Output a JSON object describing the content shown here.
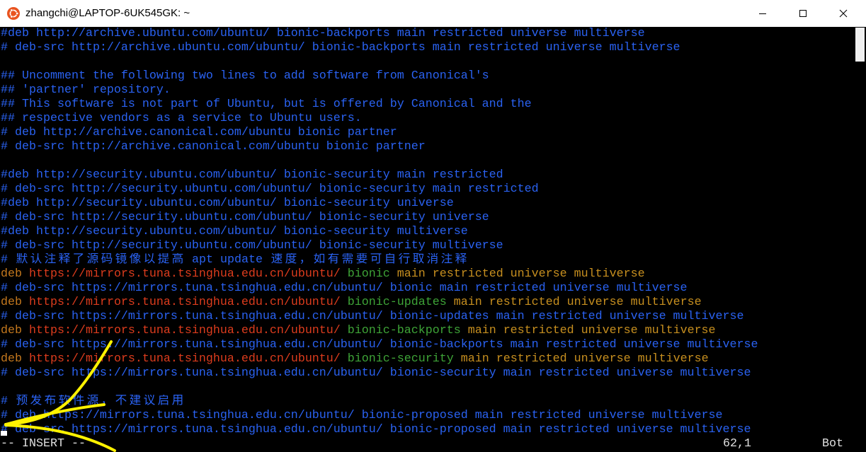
{
  "window": {
    "title": "zhangchi@LAPTOP-6UK545GK: ~",
    "icon": "ubuntu-logo-icon",
    "controls": [
      "minimize-icon",
      "maximize-icon",
      "close-icon"
    ]
  },
  "colors": {
    "comment": "#2a62f2",
    "keyword": "#c4781d",
    "url": "#dd3c1d",
    "release": "#3ea437",
    "components": "#c78f1f",
    "status_text": "#e0e0e0",
    "terminal_bg": "#000000",
    "ubuntu_orange": "#e95420",
    "annotation_arrow": "#fff200",
    "cursor": "#ffffff"
  },
  "terminal": {
    "lines": [
      {
        "segments": [
          {
            "text": "#deb http://archive.ubuntu.com/ubuntu/ bionic-backports main restricted universe multiverse",
            "style": "comment"
          }
        ]
      },
      {
        "segments": [
          {
            "text": "# deb-src http://archive.ubuntu.com/ubuntu/ bionic-backports main restricted universe multiverse",
            "style": "comment"
          }
        ]
      },
      {
        "segments": []
      },
      {
        "segments": [
          {
            "text": "## Uncomment the following two lines to add software from Canonical's",
            "style": "comment"
          }
        ]
      },
      {
        "segments": [
          {
            "text": "## 'partner' repository.",
            "style": "comment"
          }
        ]
      },
      {
        "segments": [
          {
            "text": "## This software is not part of Ubuntu, but is offered by Canonical and the",
            "style": "comment"
          }
        ]
      },
      {
        "segments": [
          {
            "text": "## respective vendors as a service to Ubuntu users.",
            "style": "comment"
          }
        ]
      },
      {
        "segments": [
          {
            "text": "# deb http://archive.canonical.com/ubuntu bionic partner",
            "style": "comment"
          }
        ]
      },
      {
        "segments": [
          {
            "text": "# deb-src http://archive.canonical.com/ubuntu bionic partner",
            "style": "comment"
          }
        ]
      },
      {
        "segments": []
      },
      {
        "segments": [
          {
            "text": "#deb http://security.ubuntu.com/ubuntu/ bionic-security main restricted",
            "style": "comment"
          }
        ]
      },
      {
        "segments": [
          {
            "text": "# deb-src http://security.ubuntu.com/ubuntu/ bionic-security main restricted",
            "style": "comment"
          }
        ]
      },
      {
        "segments": [
          {
            "text": "#deb http://security.ubuntu.com/ubuntu/ bionic-security universe",
            "style": "comment"
          }
        ]
      },
      {
        "segments": [
          {
            "text": "# deb-src http://security.ubuntu.com/ubuntu/ bionic-security universe",
            "style": "comment"
          }
        ]
      },
      {
        "segments": [
          {
            "text": "#deb http://security.ubuntu.com/ubuntu/ bionic-security multiverse",
            "style": "comment"
          }
        ]
      },
      {
        "segments": [
          {
            "text": "# deb-src http://security.ubuntu.com/ubuntu/ bionic-security multiverse",
            "style": "comment"
          }
        ]
      },
      {
        "segments": [
          {
            "text": "# 默认注释了源码镜像以提高 apt update 速度，如有需要可自行取消注释",
            "style": "comment"
          }
        ]
      },
      {
        "segments": [
          {
            "text": "deb",
            "style": "keyword"
          },
          {
            "text": " https://mirrors.tuna.tsinghua.edu.cn/ubuntu/",
            "style": "url"
          },
          {
            "text": " bionic",
            "style": "release"
          },
          {
            "text": " main restricted universe multiverse",
            "style": "components"
          }
        ]
      },
      {
        "segments": [
          {
            "text": "# deb-src https://mirrors.tuna.tsinghua.edu.cn/ubuntu/ bionic main restricted universe multiverse",
            "style": "comment"
          }
        ]
      },
      {
        "segments": [
          {
            "text": "deb",
            "style": "keyword"
          },
          {
            "text": " https://mirrors.tuna.tsinghua.edu.cn/ubuntu/",
            "style": "url"
          },
          {
            "text": " bionic-updates",
            "style": "release"
          },
          {
            "text": " main restricted universe multiverse",
            "style": "components"
          }
        ]
      },
      {
        "segments": [
          {
            "text": "# deb-src https://mirrors.tuna.tsinghua.edu.cn/ubuntu/ bionic-updates main restricted universe multiverse",
            "style": "comment"
          }
        ]
      },
      {
        "segments": [
          {
            "text": "deb",
            "style": "keyword"
          },
          {
            "text": " https://mirrors.tuna.tsinghua.edu.cn/ubuntu/",
            "style": "url"
          },
          {
            "text": " bionic-backports",
            "style": "release"
          },
          {
            "text": " main restricted universe multiverse",
            "style": "components"
          }
        ]
      },
      {
        "segments": [
          {
            "text": "# deb-src https://mirrors.tuna.tsinghua.edu.cn/ubuntu/ bionic-backports main restricted universe multiverse",
            "style": "comment"
          }
        ]
      },
      {
        "segments": [
          {
            "text": "deb",
            "style": "keyword"
          },
          {
            "text": " https://mirrors.tuna.tsinghua.edu.cn/ubuntu/",
            "style": "url"
          },
          {
            "text": " bionic-security",
            "style": "release"
          },
          {
            "text": " main restricted universe multiverse",
            "style": "components"
          }
        ]
      },
      {
        "segments": [
          {
            "text": "# deb-src https://mirrors.tuna.tsinghua.edu.cn/ubuntu/ bionic-security main restricted universe multiverse",
            "style": "comment"
          }
        ]
      },
      {
        "segments": []
      },
      {
        "segments": [
          {
            "text": "# 预发布软件源，不建议启用",
            "style": "comment"
          }
        ]
      },
      {
        "segments": [
          {
            "text": "# deb https://mirrors.tuna.tsinghua.edu.cn/ubuntu/ bionic-proposed main restricted universe multiverse",
            "style": "comment"
          }
        ]
      },
      {
        "segments": [
          {
            "text": "# deb-src https://mirrors.tuna.tsinghua.edu.cn/ubuntu/ bionic-proposed main restricted universe multiverse",
            "style": "comment"
          }
        ]
      }
    ]
  },
  "status_line": {
    "mode": "-- INSERT --",
    "position": "62,1",
    "scroll": "Bot"
  }
}
